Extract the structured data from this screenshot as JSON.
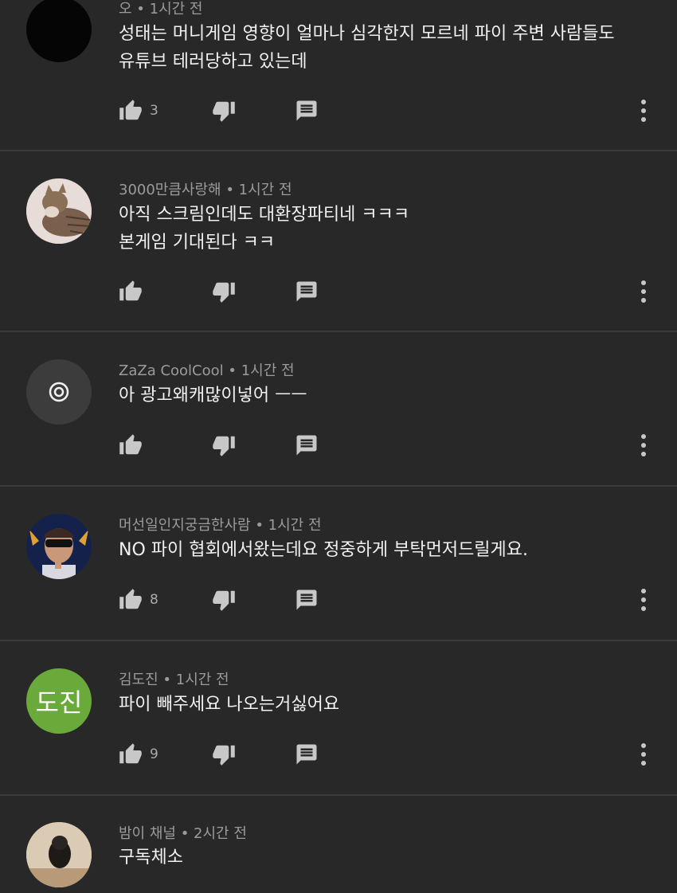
{
  "colors": {
    "background": "#282828",
    "text": "#f1f1f1",
    "meta": "#9b9b9b",
    "icon": "#c8c8c8",
    "divider": "#3a3a3a",
    "avatar_green": "#6aaa3b"
  },
  "icons": {
    "like": "thumb-up-icon",
    "dislike": "thumb-down-icon",
    "reply": "reply-icon",
    "more": "more-vert-icon"
  },
  "comments": [
    {
      "author": "오",
      "time": "1시간 전",
      "lines": [
        "성태는 머니게임 영향이 얼마나 심각한지 모르네 파이 주변 사람들도",
        "유튜브 테러당하고 있는데"
      ],
      "likes": "3"
    },
    {
      "author": "3000만큼사랑해",
      "time": "1시간 전",
      "lines": [
        "아직 스크림인데도 대환장파티네 ㅋㅋㅋ",
        "본게임 기대된다 ㅋㅋ"
      ],
      "likes": ""
    },
    {
      "author": "ZaZa CoolCool",
      "time": "1시간 전",
      "lines": [
        "아 광고왜캐많이넣어 ㅡㅡ"
      ],
      "likes": ""
    },
    {
      "author": "머선일인지궁금한사람",
      "time": "1시간 전",
      "lines": [
        "NO 파이 협회에서왔는데요 정중하게 부탁먼저드릴게요."
      ],
      "likes": "8"
    },
    {
      "author": "김도진",
      "time": "1시간 전",
      "lines": [
        "파이 빼주세요 나오는거싫어요"
      ],
      "likes": "9",
      "avatar_text": "도진"
    },
    {
      "author": "밤이 채널",
      "time": "2시간 전",
      "lines": [
        "구독체소"
      ],
      "likes": ""
    }
  ]
}
